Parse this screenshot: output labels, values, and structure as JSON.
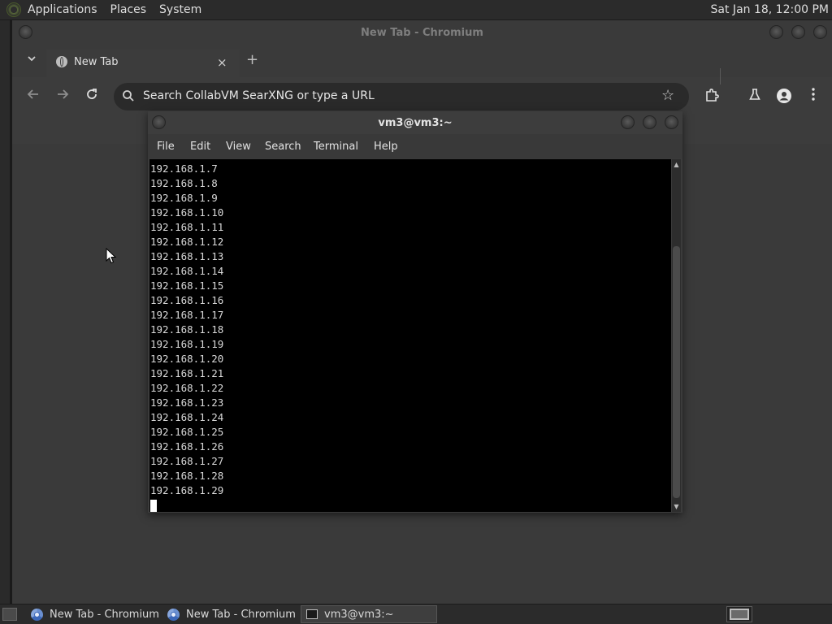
{
  "top_panel": {
    "menus": [
      "Applications",
      "Places",
      "System"
    ],
    "clock": "Sat Jan 18, 12:00 PM"
  },
  "chromium": {
    "window_title": "New Tab - Chromium",
    "tab": {
      "title": "New Tab",
      "close": "×",
      "new_tab": "+"
    },
    "toolbar": {
      "omnibox_placeholder": "Search CollabVM SearXNG or type a URL",
      "back_icon": "arrow-left",
      "forward_icon": "arrow-right",
      "reload_icon": "reload",
      "star_icon": "star",
      "extensions_icon": "puzzle",
      "labs_icon": "flask",
      "profile_icon": "person",
      "menu_icon": "three-dots"
    }
  },
  "terminal": {
    "title": "vm3@vm3:~",
    "menus": [
      "File",
      "Edit",
      "View",
      "Search",
      "Terminal",
      "Help"
    ],
    "lines": [
      "192.168.1.7",
      "192.168.1.8",
      "192.168.1.9",
      "192.168.1.10",
      "192.168.1.11",
      "192.168.1.12",
      "192.168.1.13",
      "192.168.1.14",
      "192.168.1.15",
      "192.168.1.16",
      "192.168.1.17",
      "192.168.1.18",
      "192.168.1.19",
      "192.168.1.20",
      "192.168.1.21",
      "192.168.1.22",
      "192.168.1.23",
      "192.168.1.24",
      "192.168.1.25",
      "192.168.1.26",
      "192.168.1.27",
      "192.168.1.28",
      "192.168.1.29"
    ]
  },
  "taskbar": {
    "tasks": [
      {
        "label": "New Tab - Chromium",
        "icon": "chromium"
      },
      {
        "label": "New Tab - Chromium",
        "icon": "chromium"
      },
      {
        "label": "vm3@vm3:~",
        "icon": "terminal",
        "active": true
      }
    ]
  },
  "colors": {
    "panel": "#2b2b2b",
    "chromium_bg": "#3c3c3c",
    "terminal_bg": "#000000",
    "terminal_text": "#d9d9d9"
  }
}
